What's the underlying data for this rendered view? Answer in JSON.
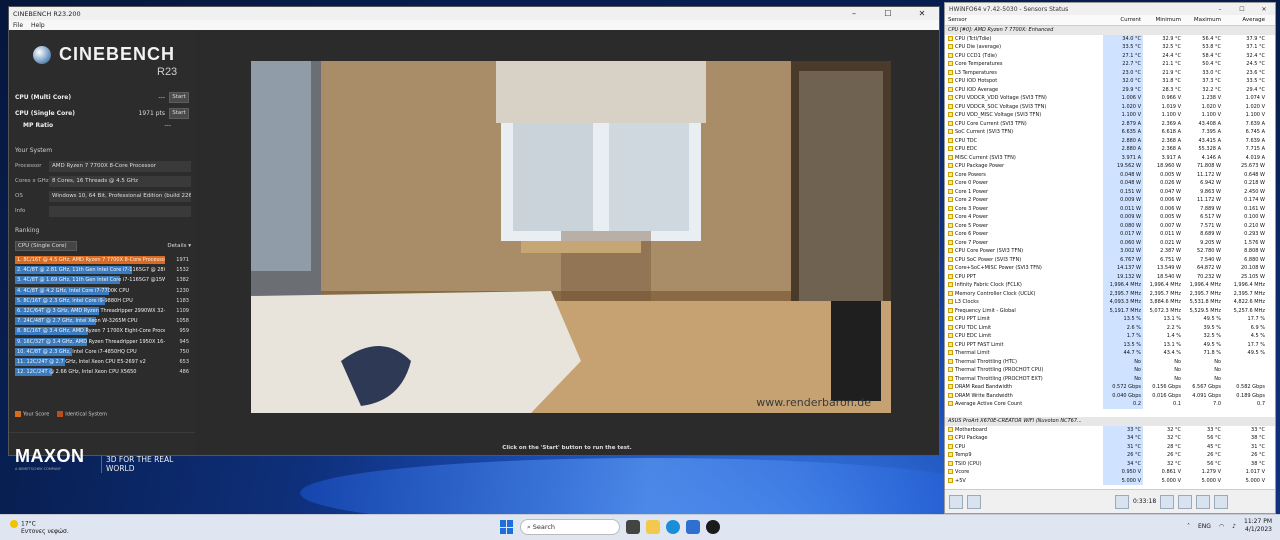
{
  "cinebench": {
    "title": "CINEBENCH R23.200",
    "menu": [
      "File",
      "Help"
    ],
    "logo_main": "CINEBENCH",
    "logo_sub": "R23",
    "tests": [
      {
        "label": "CPU (Multi Core)",
        "value": "---",
        "button": "Start"
      },
      {
        "label": "CPU (Single Core)",
        "value": "1971 pts",
        "button": "Start"
      },
      {
        "label": "MP Ratio",
        "value": "---"
      }
    ],
    "system_title": "Your System",
    "system": [
      {
        "k": "Processor",
        "v": "AMD Ryzen 7 7700X 8-Core Processor"
      },
      {
        "k": "Cores x GHz",
        "v": "8 Cores, 16 Threads @ 4.5 GHz"
      },
      {
        "k": "OS",
        "v": "Windows 10, 64 Bit, Professional Edition (build 22621)"
      },
      {
        "k": "Info",
        "v": ""
      }
    ],
    "ranking_title": "Ranking",
    "ranking_select": "CPU (Single Core)",
    "details": "Details",
    "ranking": [
      {
        "t": "1. 8C/16T @ 4.5 GHz, AMD Ryzen 7 7700X 8-Core Processor",
        "s": "1971",
        "p": 1.0,
        "own": true
      },
      {
        "t": "2. 4C/8T @ 2.81 GHz, 11th Gen Intel Core i7-1165G7 @ 28W",
        "s": "1532",
        "p": 0.777
      },
      {
        "t": "3. 4C/8T @ 1.69 GHz, 11th Gen Intel Core i7-1165G7 @15W",
        "s": "1382",
        "p": 0.701
      },
      {
        "t": "4. 4C/8T @ 4.2 GHz, Intel Core i7-7700K CPU",
        "s": "1230",
        "p": 0.624
      },
      {
        "t": "5. 8C/16T @ 2.3 GHz, Intel Core i9-9880H CPU",
        "s": "1183",
        "p": 0.6
      },
      {
        "t": "6. 32C/64T @ 3 GHz, AMD Ryzen Threadripper 2990WX 32-Core Processor",
        "s": "1109",
        "p": 0.563
      },
      {
        "t": "7. 24C/48T @ 2.7 GHz, Intel Xeon W-3265M CPU",
        "s": "1058",
        "p": 0.537
      },
      {
        "t": "8. 8C/16T @ 3.4 GHz, AMD Ryzen 7 1700X Eight-Core Processor",
        "s": "959",
        "p": 0.487
      },
      {
        "t": "9. 16C/32T @ 3.4 GHz, AMD Ryzen Threadripper 1950X 16-Core Processor",
        "s": "945",
        "p": 0.479
      },
      {
        "t": "10. 4C/8T @ 2.3 GHz, Intel Core i7-4850HQ CPU",
        "s": "750",
        "p": 0.381
      },
      {
        "t": "11. 12C/24T @ 2.7 GHz, Intel Xeon CPU E5-2697 v2",
        "s": "653",
        "p": 0.331
      },
      {
        "t": "12. 12C/24T @ 2.66 GHz, Intel Xeon CPU X5650",
        "s": "486",
        "p": 0.247
      }
    ],
    "legend": [
      "Your Score",
      "Identical System"
    ],
    "maxon": "MAXON",
    "maxon_sub": "A NEMETSCHEK COMPANY",
    "tagline": "3D FOR THE REAL WORLD",
    "status": "Click on the 'Start' button to run the test.",
    "watermark": "www.renderbaron.de"
  },
  "hwinfo": {
    "title": "HWiNFO64 v7.42-5030 - Sensors Status",
    "columns": [
      "Sensor",
      "Current",
      "Minimum",
      "Maximum",
      "Average"
    ],
    "rows": [
      [
        "CPU [#0]: AMD Ryzen 7 7700X: Enhanced",
        "",
        "",
        "",
        "",
        "g"
      ],
      [
        "CPU (Tctl/Tdie)",
        "34.0 °C",
        "32.9 °C",
        "56.4 °C",
        "37.9 °C"
      ],
      [
        "CPU Die (average)",
        "33.5 °C",
        "32.5 °C",
        "53.8 °C",
        "37.1 °C"
      ],
      [
        "CPU CCD1 (Tdie)",
        "27.1 °C",
        "24.4 °C",
        "58.4 °C",
        "32.4 °C"
      ],
      [
        "Core Temperatures",
        "22.7 °C",
        "21.1 °C",
        "50.4 °C",
        "24.5 °C"
      ],
      [
        "L3 Temperatures",
        "23.0 °C",
        "21.9 °C",
        "33.0 °C",
        "23.6 °C"
      ],
      [
        "CPU IOD Hotspot",
        "32.0 °C",
        "31.8 °C",
        "37.3 °C",
        "33.5 °C"
      ],
      [
        "CPU IOD Average",
        "29.9 °C",
        "28.3 °C",
        "32.2 °C",
        "29.4 °C"
      ],
      [
        "CPU VDDCR_VDD Voltage (SVI3 TFN)",
        "1.006 V",
        "0.966 V",
        "1.238 V",
        "1.074 V"
      ],
      [
        "CPU VDDCR_SOC Voltage (SVI3 TFN)",
        "1.020 V",
        "1.019 V",
        "1.020 V",
        "1.020 V"
      ],
      [
        "CPU VDD_MISC Voltage (SVI3 TFN)",
        "1.100 V",
        "1.100 V",
        "1.100 V",
        "1.100 V"
      ],
      [
        "CPU Core Current (SVI3 TFN)",
        "2.879 A",
        "2.369 A",
        "43.408 A",
        "7.639 A"
      ],
      [
        "SoC Current (SVI3 TFN)",
        "6.635 A",
        "6.618 A",
        "7.395 A",
        "6.745 A"
      ],
      [
        "CPU TDC",
        "2.880 A",
        "2.368 A",
        "43.415 A",
        "7.639 A"
      ],
      [
        "CPU EDC",
        "2.880 A",
        "2.368 A",
        "55.328 A",
        "7.715 A"
      ],
      [
        "MISC Current (SVI3 TFN)",
        "3.971 A",
        "3.917 A",
        "4.146 A",
        "4.019 A"
      ],
      [
        "CPU Package Power",
        "19.562 W",
        "18.960 W",
        "71.808 W",
        "25.673 W"
      ],
      [
        "Core Powers",
        "0.048 W",
        "0.005 W",
        "11.172 W",
        "0.648 W"
      ],
      [
        "Core 0 Power",
        "0.048 W",
        "0.026 W",
        "6.942 W",
        "0.218 W"
      ],
      [
        "Core 1 Power",
        "0.151 W",
        "0.047 W",
        "9.863 W",
        "2.450 W"
      ],
      [
        "Core 2 Power",
        "0.009 W",
        "0.006 W",
        "11.172 W",
        "0.174 W"
      ],
      [
        "Core 3 Power",
        "0.011 W",
        "0.006 W",
        "7.889 W",
        "0.161 W"
      ],
      [
        "Core 4 Power",
        "0.009 W",
        "0.005 W",
        "6.517 W",
        "0.100 W"
      ],
      [
        "Core 5 Power",
        "0.080 W",
        "0.007 W",
        "7.571 W",
        "0.210 W"
      ],
      [
        "Core 6 Power",
        "0.017 W",
        "0.011 W",
        "8.689 W",
        "0.293 W"
      ],
      [
        "Core 7 Power",
        "0.060 W",
        "0.021 W",
        "9.205 W",
        "1.576 W"
      ],
      [
        "CPU Core Power (SVI3 TFN)",
        "3.002 W",
        "2.387 W",
        "52.780 W",
        "8.808 W"
      ],
      [
        "CPU SoC Power (SVI3 TFN)",
        "6.767 W",
        "6.751 W",
        "7.540 W",
        "6.880 W"
      ],
      [
        "Core+SoC+MISC Power (SVI3 TFN)",
        "14.137 W",
        "13.549 W",
        "64.872 W",
        "20.108 W"
      ],
      [
        "CPU PPT",
        "19.132 W",
        "18.540 W",
        "70.232 W",
        "25.105 W"
      ],
      [
        "Infinity Fabric Clock (FCLK)",
        "1,996.4 MHz",
        "1,996.4 MHz",
        "1,996.4 MHz",
        "1,996.4 MHz"
      ],
      [
        "Memory Controller Clock (UCLK)",
        "2,395.7 MHz",
        "2,395.7 MHz",
        "2,395.7 MHz",
        "2,395.7 MHz"
      ],
      [
        "L3 Clocks",
        "4,093.3 MHz",
        "3,884.6 MHz",
        "5,531.8 MHz",
        "4,822.6 MHz"
      ],
      [
        "Frequency Limit - Global",
        "5,191.7 MHz",
        "5,072.3 MHz",
        "5,529.5 MHz",
        "5,257.6 MHz"
      ],
      [
        "CPU PPT Limit",
        "13.5 %",
        "13.1 %",
        "49.5 %",
        "17.7 %"
      ],
      [
        "CPU TDC Limit",
        "2.6 %",
        "2.2 %",
        "39.5 %",
        "6.9 %"
      ],
      [
        "CPU EDC Limit",
        "1.7 %",
        "1.4 %",
        "32.5 %",
        "4.5 %"
      ],
      [
        "CPU PPT FAST Limit",
        "13.5 %",
        "13.1 %",
        "49.5 %",
        "17.7 %"
      ],
      [
        "Thermal Limit",
        "44.7 %",
        "43.4 %",
        "71.8 %",
        "49.5 %"
      ],
      [
        "Thermal Throttling (HTC)",
        "No",
        "No",
        "No",
        ""
      ],
      [
        "Thermal Throttling (PROCHOT CPU)",
        "No",
        "No",
        "No",
        ""
      ],
      [
        "Thermal Throttling (PROCHOT EXT)",
        "No",
        "No",
        "No",
        ""
      ],
      [
        "DRAM Read Bandwidth",
        "0.572 Gbps",
        "0.156 Gbps",
        "6.567 Gbps",
        "0.582 Gbps"
      ],
      [
        "DRAM Write Bandwidth",
        "0.040 Gbps",
        "0.016 Gbps",
        "4.091 Gbps",
        "0.189 Gbps"
      ],
      [
        "Average Active Core Count",
        "0.2",
        "0.1",
        "7.0",
        "0.7"
      ],
      [
        "",
        "",
        "",
        "",
        "",
        ""
      ],
      [
        "ASUS ProArt X670E-CREATOR WIFI (Nuvoton NCT67...",
        "",
        "",
        "",
        "",
        "g"
      ],
      [
        "Motherboard",
        "33 °C",
        "32 °C",
        "33 °C",
        "33 °C"
      ],
      [
        "CPU Package",
        "34 °C",
        "32 °C",
        "56 °C",
        "38 °C"
      ],
      [
        "CPU",
        "31 °C",
        "28 °C",
        "45 °C",
        "31 °C"
      ],
      [
        "Temp9",
        "26 °C",
        "26 °C",
        "26 °C",
        "26 °C"
      ],
      [
        "TSI0 (CPU)",
        "34 °C",
        "32 °C",
        "56 °C",
        "38 °C"
      ],
      [
        "Vcore",
        "0.950 V",
        "0.861 V",
        "1.279 V",
        "1.017 V"
      ],
      [
        "+5V",
        "5.000 V",
        "5.000 V",
        "5.000 V",
        "5.000 V"
      ]
    ],
    "timer": "0:33:18"
  },
  "taskbar": {
    "weather_temp": "17°C",
    "weather_desc": "Εντονες νεφώσ.",
    "search": "Search",
    "lang": "ENG",
    "time": "11:27 PM",
    "date": "4/1/2023"
  }
}
